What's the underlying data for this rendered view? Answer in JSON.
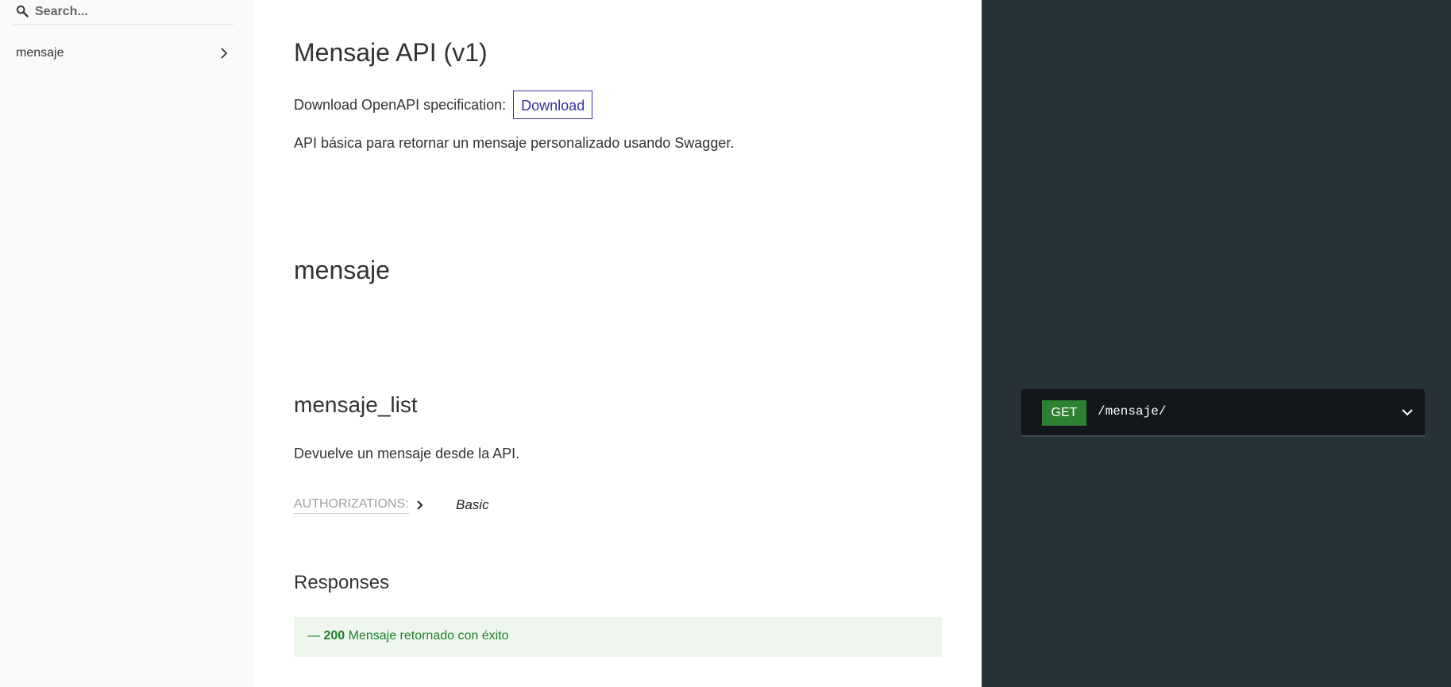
{
  "sidebar": {
    "search": {
      "placeholder": "Search...",
      "value": ""
    },
    "items": [
      {
        "label": "mensaje"
      }
    ]
  },
  "main": {
    "title": "Mensaje API (v1)",
    "download": {
      "text": "Download OpenAPI specification:",
      "button_label": "Download"
    },
    "description": "API básica para retornar un mensaje personalizado usando Swagger.",
    "section_title": "mensaje",
    "operation": {
      "title": "mensaje_list",
      "description": "Devuelve un mensaje desde la API.",
      "authorizations_label": "AUTHORIZATIONS:",
      "authorization_value": "Basic",
      "responses_title": "Responses",
      "responses": [
        {
          "prefix": "— ",
          "code": "200",
          "description": "Mensaje retornado con éxito"
        }
      ]
    }
  },
  "right_panel": {
    "endpoint": {
      "method": "GET",
      "path": "/mensaje/"
    }
  },
  "colors": {
    "sidebar_bg": "#fafafa",
    "right_panel_bg": "#263238",
    "endpoint_bg": "#11171a",
    "get_badge": "#2f8132",
    "download_accent": "#32329f",
    "response_success_bg": "#eef6ee",
    "response_success_text": "#1d8127"
  }
}
